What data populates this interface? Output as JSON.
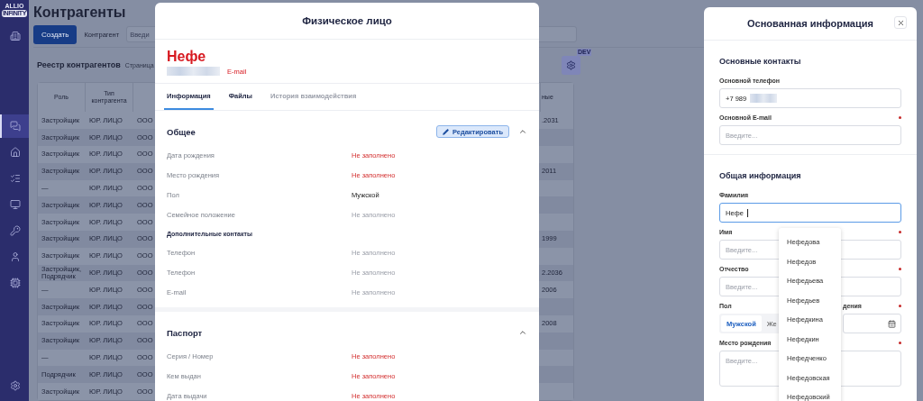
{
  "sidebar": {
    "logo_top": "ALLIO",
    "logo_bottom": "INFINITY",
    "items": [
      {
        "selected": false
      },
      {
        "selected": true
      },
      {
        "selected": false
      },
      {
        "selected": false
      },
      {
        "selected": false
      },
      {
        "selected": false
      },
      {
        "selected": false
      },
      {
        "selected": false
      }
    ]
  },
  "page": {
    "title": "Контрагенты",
    "create_button": "Создать",
    "filter_label": "Контрагент",
    "filter_placeholder": "Введи",
    "registry_title": "Реестр контрагентов",
    "page_label": "Страница",
    "settings_badge": "DEV"
  },
  "table": {
    "headers": {
      "role": "Роль",
      "type": "Тип контрагента",
      "column_4": "ные"
    },
    "rows": [
      {
        "role": "Застройщик",
        "type": "ЮР. ЛИЦО",
        "column_3": "ООО",
        "column_4": ".2031"
      },
      {
        "role": "Застройщик",
        "type": "ЮР. ЛИЦО",
        "column_3": "ООО"
      },
      {
        "role": "Застройщик",
        "type": "ЮР. ЛИЦО",
        "column_3": "ООО"
      },
      {
        "role": "Застройщик",
        "type": "ЮР. ЛИЦО",
        "column_3": "ООО",
        "column_4": "2011"
      },
      {
        "role": "—",
        "type": "ЮР. ЛИЦО",
        "column_3": "ООО"
      },
      {
        "role": "Застройщик",
        "type": "ЮР. ЛИЦО",
        "column_3": "ООО"
      },
      {
        "role": "Застройщик",
        "type": "ЮР. ЛИЦО",
        "column_3": "ООО"
      },
      {
        "role": "Застройщик",
        "type": "ЮР. ЛИЦО",
        "column_3": "ООО",
        "column_4": "1999"
      },
      {
        "role": "Застройщик",
        "type": "ЮР. ЛИЦО",
        "column_3": "ООО"
      },
      {
        "role": "Застройщик, Подрядчик",
        "type": "ЮР. ЛИЦО",
        "column_3": "ООО",
        "column_4": "2.2036"
      },
      {
        "role": "—",
        "type": "ЮР. ЛИЦО",
        "column_3": "ООО",
        "column_4": "2006"
      },
      {
        "role": "Застройщик",
        "type": "ЮР. ЛИЦО",
        "column_3": "ООО"
      },
      {
        "role": "Застройщик",
        "type": "ЮР. ЛИЦО",
        "column_3": "ООО",
        "column_4": "2008"
      },
      {
        "role": "Застройщик",
        "type": "ЮР. ЛИЦО",
        "column_3": "ООО"
      },
      {
        "role": "—",
        "type": "ЮР. ЛИЦО",
        "column_3": "ООО"
      },
      {
        "role": "Подрядчик",
        "type": "ЮР. ЛИЦО",
        "column_3": "ООО"
      },
      {
        "role": "Застройщик",
        "type": "ЮР. ЛИЦО",
        "column_3": "ООО"
      }
    ]
  },
  "person_modal": {
    "title": "Физическое лицо",
    "name": "Нефе",
    "email_link": "E-mail",
    "tabs": [
      {
        "label": "Информация",
        "selected": true,
        "disabled": false
      },
      {
        "label": "Файлы",
        "selected": false,
        "disabled": false
      },
      {
        "label": "История взаимодействия",
        "selected": false,
        "disabled": true
      }
    ],
    "sections": [
      {
        "title": "Общее",
        "edit_button": "Редактировать",
        "expanded": true,
        "rows": [
          {
            "kind": "field",
            "label": "Дата рождения",
            "placeholder": "Не заполнено",
            "required": true
          },
          {
            "kind": "field",
            "label": "Место рождения",
            "placeholder": "Не заполнено",
            "required": true
          },
          {
            "kind": "field",
            "label": "Пол",
            "value": "Мужской"
          },
          {
            "kind": "field",
            "label": "Семейное положение",
            "placeholder": "Не заполнено",
            "required": false
          },
          {
            "kind": "subheading",
            "label": "Дополнительные контакты"
          },
          {
            "kind": "field",
            "label": "Телефон",
            "placeholder": "Не заполнено",
            "required": false
          },
          {
            "kind": "field",
            "label": "Телефон",
            "placeholder": "Не заполнено",
            "required": false
          },
          {
            "kind": "field",
            "label": "E-mail",
            "placeholder": "Не заполнено",
            "required": false
          }
        ]
      },
      {
        "title": "Паспорт",
        "expanded": true,
        "rows": [
          {
            "kind": "field",
            "label": "Серия / Номер",
            "placeholder": "Не заполнено",
            "required": true
          },
          {
            "kind": "field",
            "label": "Кем выдан",
            "placeholder": "Не заполнено",
            "required": true
          },
          {
            "kind": "field",
            "label": "Дата выдачи",
            "placeholder": "Не заполнено",
            "required": true
          }
        ]
      }
    ]
  },
  "drawer": {
    "title": "Основанная информация",
    "contacts": {
      "title": "Основные контакты",
      "phone_label": "Основной телефон",
      "phone_value": "+7 989",
      "email_label": "Основной E-mail",
      "email_required": true,
      "email_placeholder": "Введите..."
    },
    "general": {
      "title": "Общая информация",
      "surname_label": "Фамилия",
      "surname_value": "Нефе",
      "surname_focused": true,
      "name_label": "Имя",
      "name_required": true,
      "name_placeholder": "Введите...",
      "patronymic_label": "Отчество",
      "patronymic_required": true,
      "patronymic_placeholder": "Введите...",
      "gender_label": "Пол",
      "gender_options": [
        {
          "label": "Мужской",
          "selected": true
        },
        {
          "label": "Же",
          "selected": false
        }
      ],
      "birthdate_label": "дения",
      "birthdate_required": true,
      "birthplace_label": "Место рождения",
      "birthplace_required": true,
      "birthplace_placeholder": "Введите..."
    },
    "suggestions": [
      "Нефедова",
      "Нефедов",
      "Нефедьева",
      "Нефедьев",
      "Нефедкина",
      "Нефедкин",
      "Нефедченко",
      "Нефедовская",
      "Нефедовский"
    ]
  }
}
